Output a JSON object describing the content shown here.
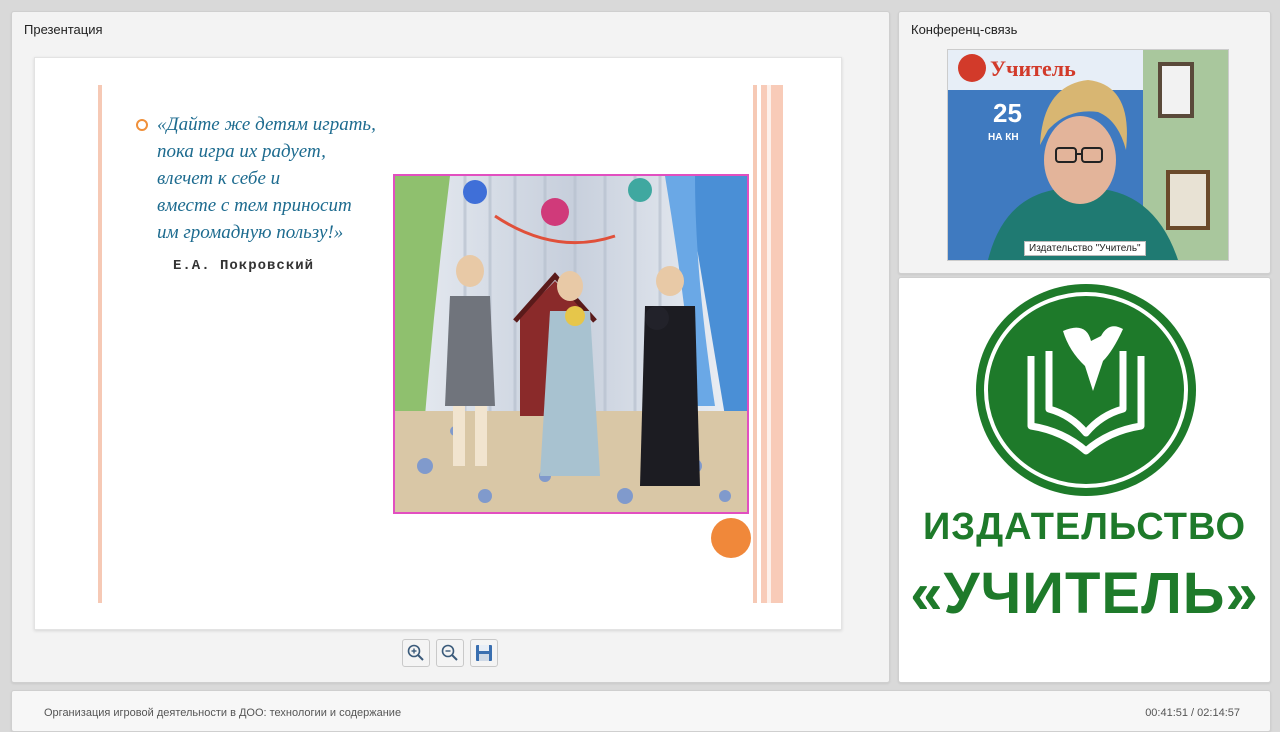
{
  "presentation": {
    "title": "Презентация",
    "slide": {
      "quote_lines": [
        "«Дайте же детям играть,",
        "пока игра их радует,",
        "влечет к себе и",
        "вместе с тем приносит",
        "им громадную пользу!»"
      ],
      "author": "Е.А. Покровский",
      "photo_icon": "children-performance-photo",
      "accent_colors": {
        "lines": "#f6c9b5",
        "dot": "#f0883a",
        "photo_frame": "#e24fc0",
        "quote_text": "#1d6b8f"
      }
    },
    "toolbar": {
      "zoom_in_icon": "zoom-in-icon",
      "zoom_out_icon": "zoom-out-icon",
      "save_icon": "save-icon"
    }
  },
  "conference": {
    "title": "Конференц-связь",
    "video_caption": "Издательство \"Учитель\"",
    "background_sign": "Учитель",
    "background_sign_number": "25",
    "background_sign_sub": "НА КН"
  },
  "logo": {
    "line1": "ИЗДАТЕЛЬСТВО",
    "line2": "«УЧИТЕЛЬ»",
    "color": "#1e7a2a"
  },
  "footer": {
    "course_title": "Организация игровой деятельности в ДОО: технологии и содержание",
    "time": "00:41:51 / 02:14:57"
  }
}
